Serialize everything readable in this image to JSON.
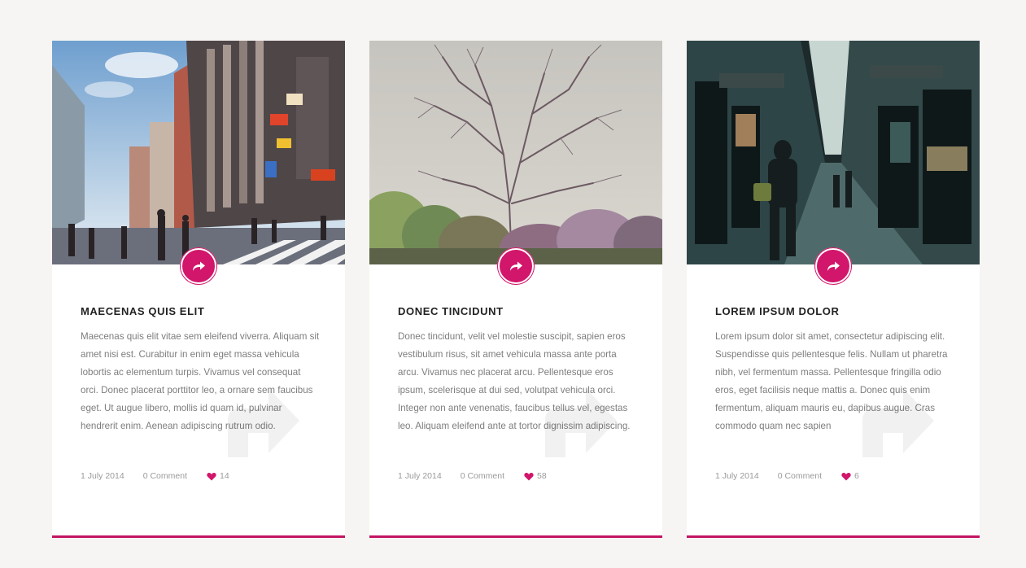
{
  "accent_color": "#c21563",
  "cards": [
    {
      "image_alt": "city street crossing with tall buildings",
      "title": "MAECENAS QUIS ELIT",
      "body": "Maecenas quis elit vitae sem eleifend viverra. Aliquam sit amet nisi est. Curabitur in enim eget massa vehicula lobortis ac elementum turpis. Vivamus vel consequat orci. Donec placerat porttitor leo, a ornare sem faucibus eget. Ut augue libero, mollis id quam id, pulvinar hendrerit enim. Aenean adipiscing rutrum odio.",
      "date": "1 July 2014",
      "comments": "0 Comment",
      "likes": "14",
      "share_icon": "share-arrow-icon",
      "like_icon": "heart-icon"
    },
    {
      "image_alt": "bare tree against pale sky",
      "title": "DONEC TINCIDUNT",
      "body": "Donec tincidunt, velit vel molestie suscipit, sapien eros vestibulum risus, sit amet vehicula massa ante porta arcu. Vivamus nec placerat arcu. Pellentesque eros ipsum, scelerisque at dui sed, volutpat vehicula orci. Integer non ante venenatis, faucibus tellus vel, egestas leo. Aliquam eleifend ante at tortor dignissim adipiscing.",
      "date": "1 July 2014",
      "comments": "0 Comment",
      "likes": "58",
      "share_icon": "share-arrow-icon",
      "like_icon": "heart-icon"
    },
    {
      "image_alt": "narrow alley with shops and pedestrians",
      "title": "LOREM IPSUM DOLOR",
      "body": "Lorem ipsum dolor sit amet, consectetur adipiscing elit. Suspendisse quis pellentesque felis. Nullam ut pharetra nibh, vel fermentum massa. Pellentesque fringilla odio eros, eget facilisis neque mattis a. Donec quis enim fermentum, aliquam mauris eu, dapibus augue. Cras commodo quam nec sapien",
      "date": "1 July 2014",
      "comments": "0 Comment",
      "likes": "6",
      "share_icon": "share-arrow-icon",
      "like_icon": "heart-icon"
    }
  ]
}
